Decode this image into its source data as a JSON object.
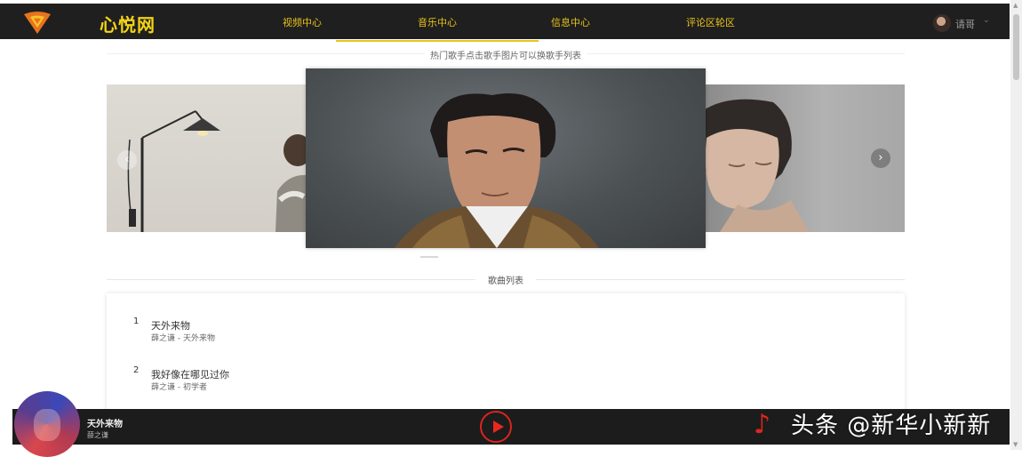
{
  "nav": {
    "site_name": "心悦网",
    "items": [
      "视频中心",
      "音乐中心",
      "信息中心",
      "评论区轮区"
    ],
    "active": 1,
    "user_name": "请哥",
    "caret": "⌄"
  },
  "hint": "热门歌手点击歌手图片可以换歌手列表",
  "carousel": {
    "prev": "‹",
    "next": "›"
  },
  "list_title": "歌曲列表",
  "songs": [
    {
      "no": "1",
      "title": "天外来物",
      "sub": "薛之谦 - 天外来物"
    },
    {
      "no": "2",
      "title": "我好像在哪见过你",
      "sub": "薛之谦 - 初学者"
    }
  ],
  "player": {
    "title": "天外来物",
    "artist": "薛之谦"
  },
  "watermark": "头条 @新华小新新",
  "scroll": {
    "up": "▲",
    "down": "▼"
  },
  "note_glyph": "♪",
  "colors": {
    "accent": "#e8c21a",
    "play": "#e8281f",
    "nav_bg": "#1f1f1f"
  }
}
